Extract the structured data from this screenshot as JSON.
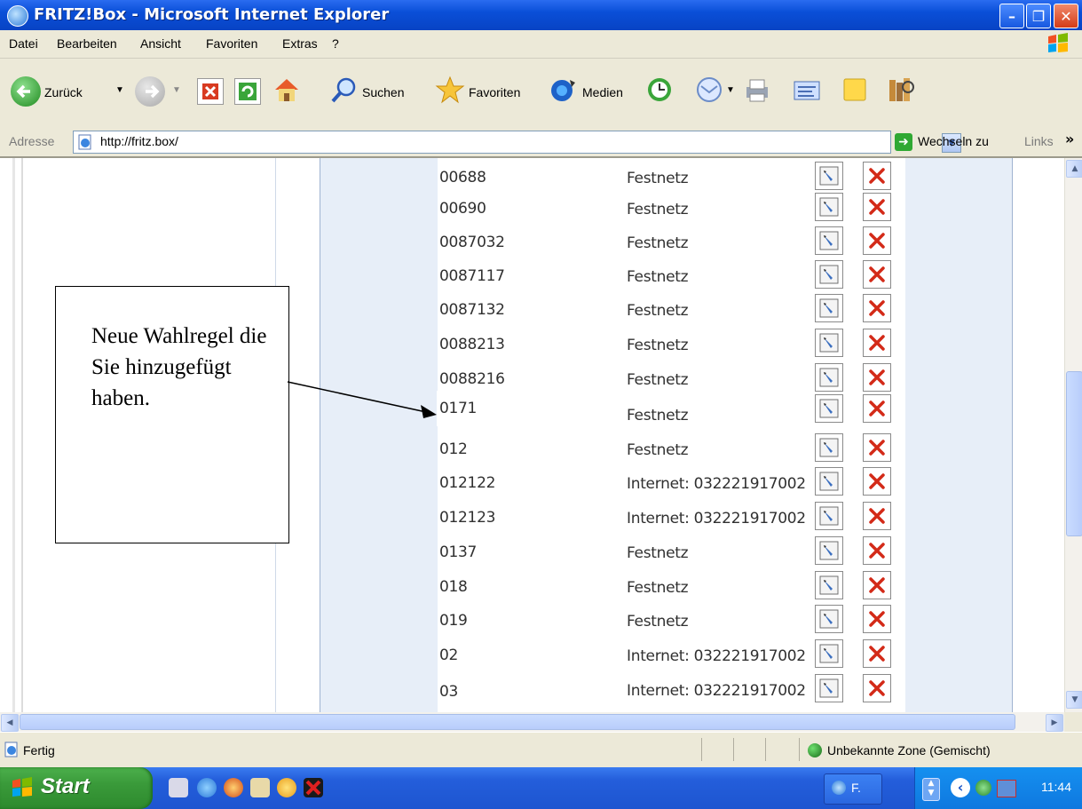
{
  "window": {
    "title": "FRITZ!Box - Microsoft Internet Explorer"
  },
  "menu": [
    "Datei",
    "Bearbeiten",
    "Ansicht",
    "Favoriten",
    "Extras",
    "?"
  ],
  "toolbar": {
    "back": "Zurück",
    "search": "Suchen",
    "favorites": "Favoriten",
    "media": "Medien"
  },
  "address": {
    "label": "Adresse",
    "url": "http://fritz.box/",
    "go": "Wechseln zu",
    "links": "Links"
  },
  "rules": [
    {
      "number": "00688",
      "connection": "Festnetz"
    },
    {
      "number": "00690",
      "connection": "Festnetz"
    },
    {
      "number": "0087032",
      "connection": "Festnetz"
    },
    {
      "number": "0087117",
      "connection": "Festnetz"
    },
    {
      "number": "0087132",
      "connection": "Festnetz"
    },
    {
      "number": "0088213",
      "connection": "Festnetz"
    },
    {
      "number": "0088216",
      "connection": "Festnetz"
    },
    {
      "number": "0171",
      "connection": "Festnetz"
    },
    {
      "number": "012",
      "connection": "Festnetz"
    },
    {
      "number": "012122",
      "connection": "Internet: 032221917002"
    },
    {
      "number": "012123",
      "connection": "Internet: 032221917002"
    },
    {
      "number": "0137",
      "connection": "Festnetz"
    },
    {
      "number": "018",
      "connection": "Festnetz"
    },
    {
      "number": "019",
      "connection": "Festnetz"
    },
    {
      "number": "02",
      "connection": "Internet: 032221917002"
    },
    {
      "number": "03",
      "connection": "Internet: 032221917002"
    }
  ],
  "callout": {
    "text": "Neue Wahlregel die Sie hinzugefügt haben."
  },
  "status": {
    "text": "Fertig",
    "zone": "Unbekannte Zone (Gemischt)"
  },
  "taskbar": {
    "start": "Start",
    "task": "F.",
    "clock": "11:44"
  }
}
